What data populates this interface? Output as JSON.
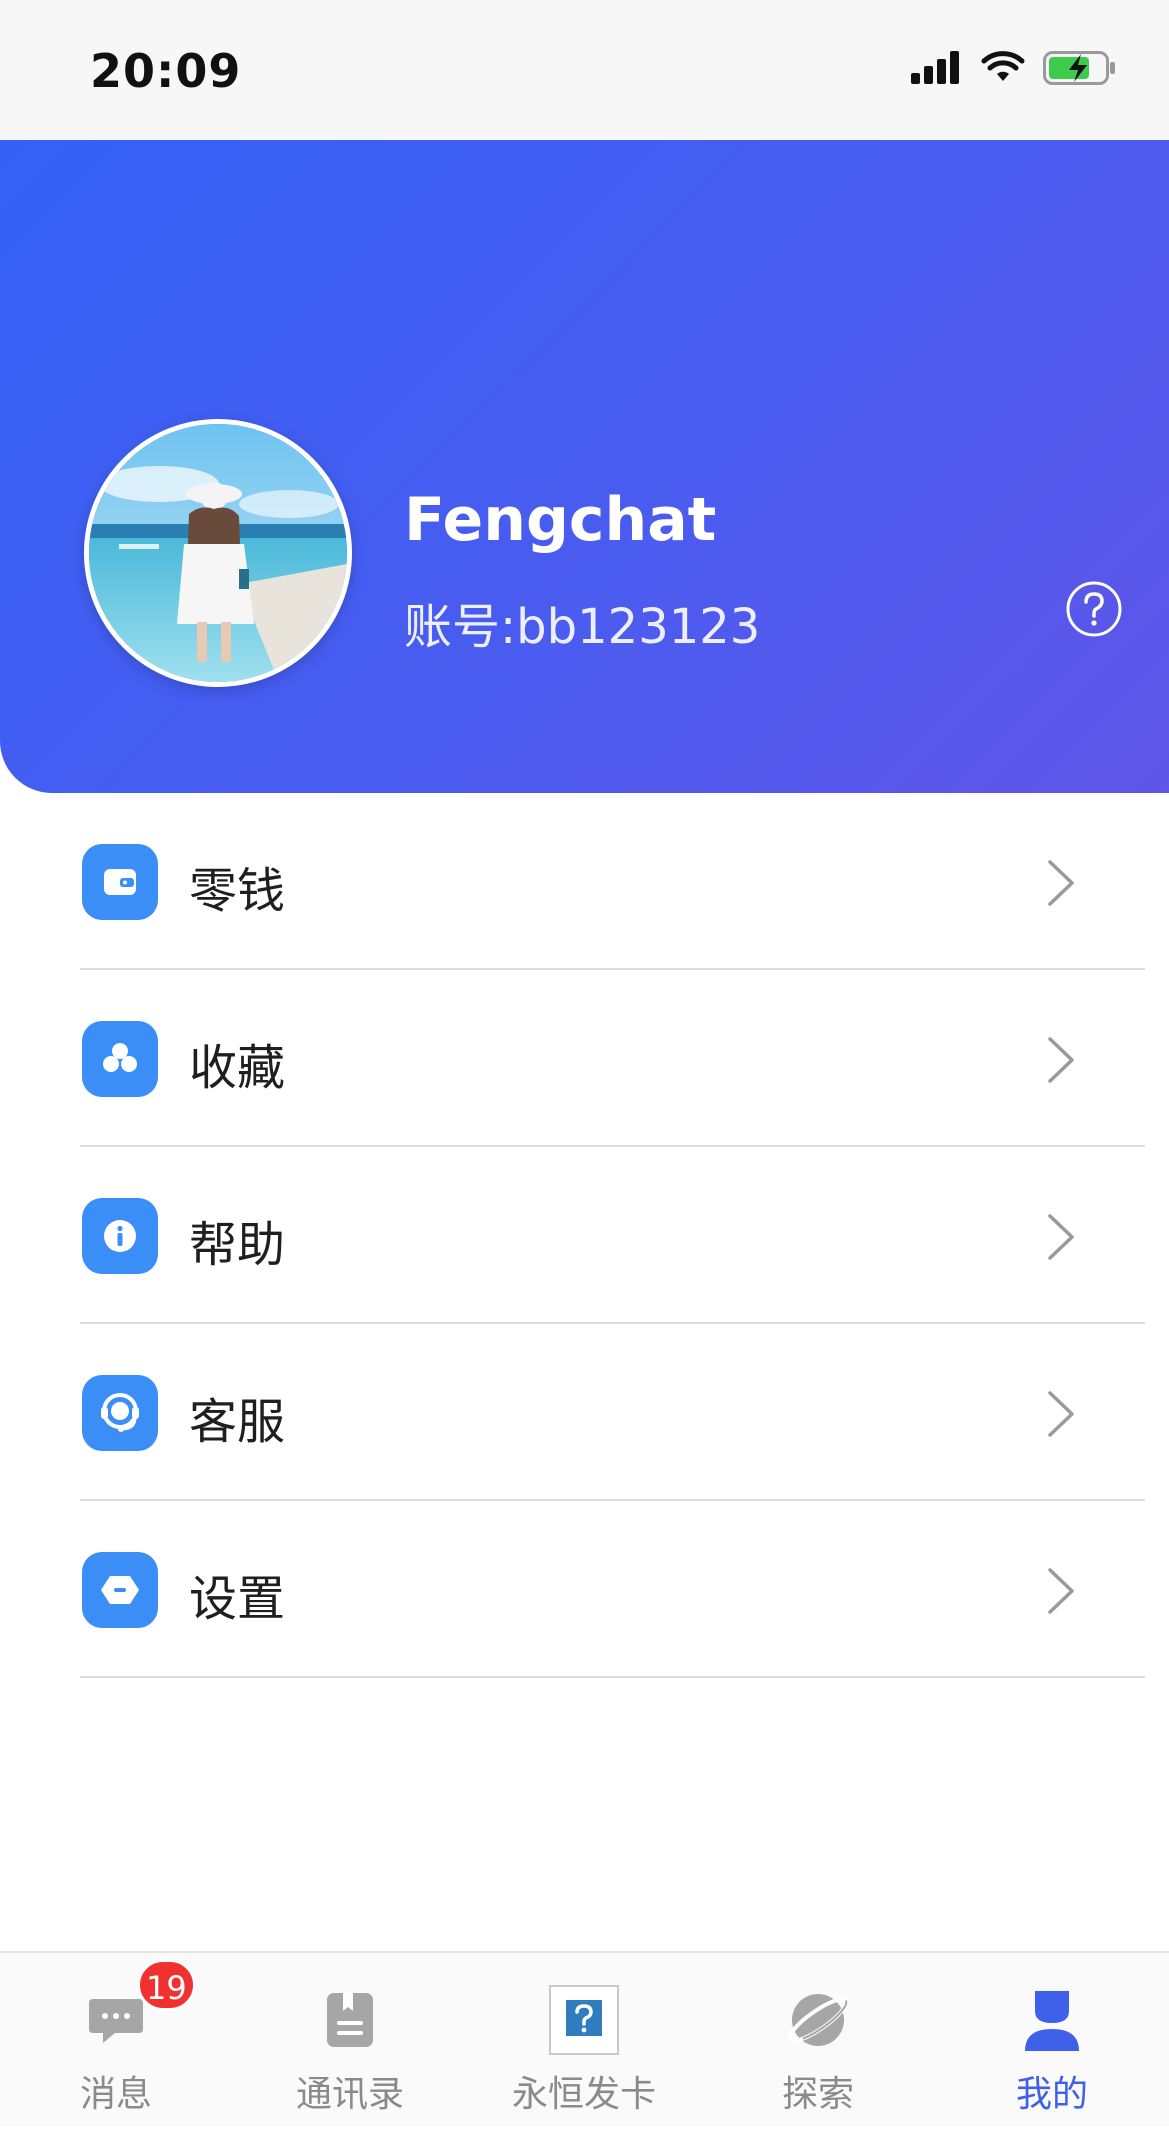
{
  "status_bar": {
    "time": "20:09"
  },
  "profile": {
    "username": "Fengchat",
    "account": "账号:bb123123"
  },
  "menu": {
    "items": [
      {
        "label": "零钱",
        "icon": "wallet-icon"
      },
      {
        "label": "收藏",
        "icon": "favorites-icon"
      },
      {
        "label": "帮助",
        "icon": "info-icon"
      },
      {
        "label": "客服",
        "icon": "headset-icon"
      },
      {
        "label": "设置",
        "icon": "settings-icon"
      }
    ]
  },
  "tabbar": {
    "tabs": [
      {
        "label": "消息",
        "icon": "chat-icon",
        "badge": "19"
      },
      {
        "label": "通讯录",
        "icon": "contacts-icon"
      },
      {
        "label": "永恒发卡",
        "icon": "question-card-icon"
      },
      {
        "label": "探索",
        "icon": "planet-icon"
      },
      {
        "label": "我的",
        "icon": "user-icon",
        "active": true
      }
    ]
  },
  "colors": {
    "header_start": "#3461f5",
    "header_end": "#5f55e8",
    "menu_icon_bg": "#3b8ef6",
    "active_tab": "#3f60e8",
    "badge": "#f0312f"
  }
}
